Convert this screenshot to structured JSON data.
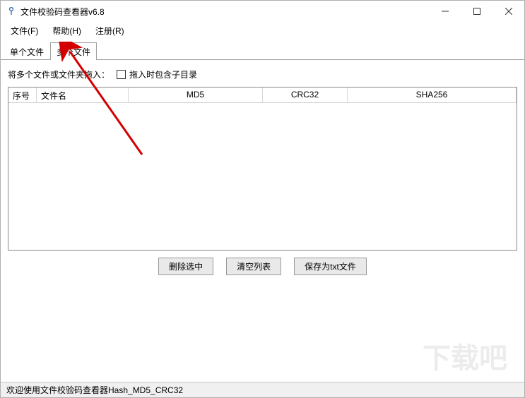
{
  "title": "文件校验码查看器v6.8",
  "menu": {
    "file": "文件(F)",
    "help": "帮助(H)",
    "register": "注册(R)"
  },
  "tabs": {
    "single": "单个文件",
    "multi": "多个文件",
    "active": "multi"
  },
  "instruct_label": "将多个文件或文件夹拖入：",
  "checkbox_label": "拖入时包含子目录",
  "checkbox_checked": false,
  "columns": {
    "seq": "序号",
    "filename": "文件名",
    "md5": "MD5",
    "crc32": "CRC32",
    "sha256": "SHA256"
  },
  "rows": [],
  "buttons": {
    "delete_sel": "删除选中",
    "clear_list": "清空列表",
    "save_txt": "保存为txt文件"
  },
  "statusbar": "欢迎使用文件校验码查看器Hash_MD5_CRC32",
  "watermark": "下载吧"
}
